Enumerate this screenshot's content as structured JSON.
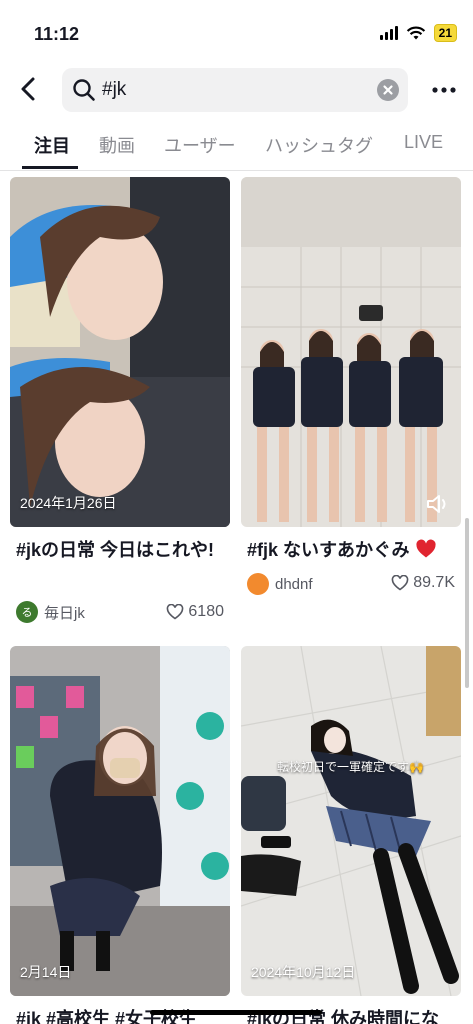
{
  "status": {
    "time": "11:12",
    "battery": "21"
  },
  "search": {
    "query": "#jk"
  },
  "tabs": [
    {
      "label": "注目"
    },
    {
      "label": "動画"
    },
    {
      "label": "ユーザー"
    },
    {
      "label": "ハッシュタグ"
    },
    {
      "label": "LIVE"
    }
  ],
  "cards": [
    {
      "date": "2024年1月26日",
      "caption": "#jkの日常 今日はこれや!",
      "author": "毎日jk",
      "avatar_letter": "る",
      "likes": "6180"
    },
    {
      "date": "",
      "caption": "#fjk ないすあかぐみ",
      "author": "dhdnf",
      "avatar_letter": "",
      "likes": "89.7K"
    },
    {
      "date": "2月14日",
      "caption": "#jk #高校生 #女子校生",
      "author": "",
      "avatar_letter": "",
      "likes": ""
    },
    {
      "date": "2024年10月12日",
      "overlay": "転校初日で一軍確定です🙌",
      "caption": "#jkの日常 休み時間にな",
      "author": "",
      "avatar_letter": "",
      "likes": ""
    }
  ],
  "colors": {
    "accent": "#fe2c55",
    "avatar1": "#3e7a2e",
    "avatar2": "#f28a2e"
  }
}
